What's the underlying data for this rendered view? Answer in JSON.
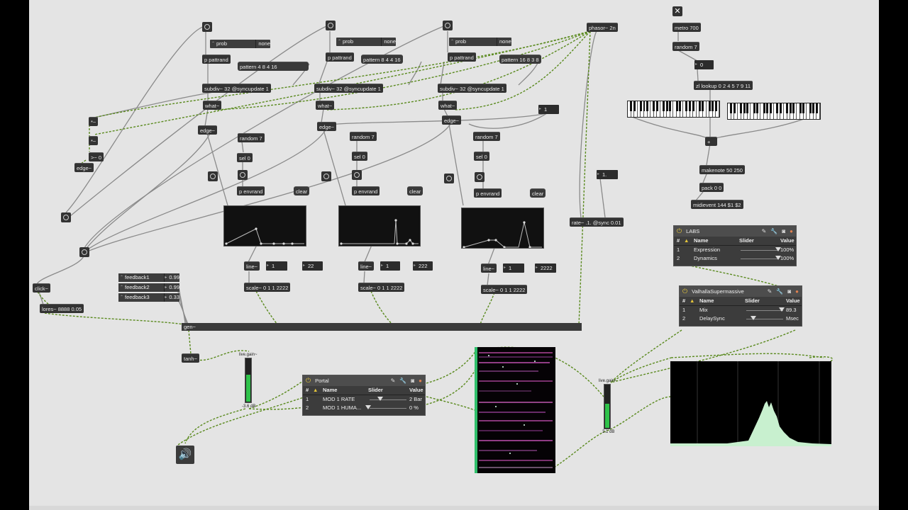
{
  "toggle": {
    "glyph": "✕"
  },
  "objects": {
    "phasor": "phasor~ 2n",
    "metro": "metro 700",
    "random7_top": "random 7",
    "num_zero": "0",
    "zl_lookup": "zl lookup 0 2 4 5 7 9 11",
    "plus": "+",
    "makenote": "makenote 50 250",
    "pack": "pack 0 0",
    "midievent": "midievent 144 $1 $2",
    "num_one_right": "1.",
    "rate": "rate~ .1. @sync 0.01",
    "num_one_mid": "1",
    "click": "click~",
    "lores": "lores~ 8888 0.05",
    "gen": "gen~",
    "tanh": "tanh~",
    "edge_left": "edge~",
    "op_mult_1": "*~",
    "op_mult_2": "*~",
    "op_gt": ">~ 0"
  },
  "voices": [
    {
      "prob": "prob",
      "none": "none",
      "pattrand": "p pattrand",
      "pattern": "pattern 4 8 4 16",
      "subdiv": "subdiv~ 32 @syncupdate 1",
      "what": "what~",
      "edge": "edge~",
      "random": "random 7",
      "sel": "sel 0",
      "envrand": "p envrand",
      "clear": "clear",
      "line": "line~",
      "num_a": "1",
      "num_b": "22",
      "scale": "scale~ 0 1 1 2222"
    },
    {
      "prob": "prob",
      "none": "none",
      "pattrand": "p pattrand",
      "pattern": "pattern 8 4 4 16",
      "subdiv": "subdiv~ 32 @syncupdate 1",
      "what": "what~",
      "edge": "edge~",
      "random": "random 7",
      "sel": "sel 0",
      "envrand": "p envrand",
      "clear": "clear",
      "line": "line~",
      "num_a": "1",
      "num_b": "222",
      "scale": "scale~ 0 1 1 2222"
    },
    {
      "prob": "prob",
      "none": "none",
      "pattrand": "p pattrand",
      "pattern": "pattern 16 8 3 8",
      "subdiv": "subdiv~ 32 @syncupdate 1",
      "what": "what~",
      "edge": "edge~",
      "random": "random 7",
      "sel": "sel 0",
      "envrand": "p envrand",
      "clear": "clear",
      "line": "line~",
      "num_a": "1",
      "num_b": "2222",
      "scale": "scale~ 0 1 1 2222"
    }
  ],
  "feedback": [
    {
      "name": "feedback1",
      "value": "0.99"
    },
    {
      "name": "feedback2",
      "value": "0.99"
    },
    {
      "name": "feedback3",
      "value": "0.33"
    }
  ],
  "plugins": {
    "labs": {
      "title": "LABS",
      "columns": [
        "#",
        "Name",
        "Slider",
        "Value"
      ],
      "rows": [
        {
          "idx": "1",
          "name": "Expression",
          "value": "100%",
          "level": 0.95
        },
        {
          "idx": "2",
          "name": "Dynamics",
          "value": "100%",
          "level": 0.95
        }
      ]
    },
    "valhalla": {
      "title": "ValhallaSupermassive",
      "columns": [
        "#",
        "Name",
        "Slider",
        "Value"
      ],
      "rows": [
        {
          "idx": "1",
          "name": "Mix",
          "value": "89.3",
          "level": 0.89
        },
        {
          "idx": "2",
          "name": "DelaySync",
          "value": "Msec",
          "level": 0.2
        }
      ]
    },
    "portal": {
      "title": "Portal",
      "columns": [
        "#",
        "Name",
        "Slider",
        "Value"
      ],
      "rows": [
        {
          "idx": "1",
          "name": "MOD 1 RATE",
          "value": "2 Bar",
          "level": 0.3
        },
        {
          "idx": "2",
          "name": "MOD 1 HUMA...",
          "value": "0 %",
          "level": 0.0
        }
      ]
    }
  },
  "meters": [
    {
      "name": "live.gain~",
      "db": "-3.6 dB",
      "level": 0.62
    },
    {
      "name": "live.gain~",
      "db": "3.1 dB",
      "level": 0.55
    }
  ],
  "colors": {
    "canvas": "#e4e4e4",
    "object": "#333333",
    "signal_cable": "#5a8a1e",
    "control_cable": "#8a8a8a",
    "meter": "#2fc24a",
    "spectrum": "#c8f0cf",
    "accent": "#e3c43a"
  }
}
